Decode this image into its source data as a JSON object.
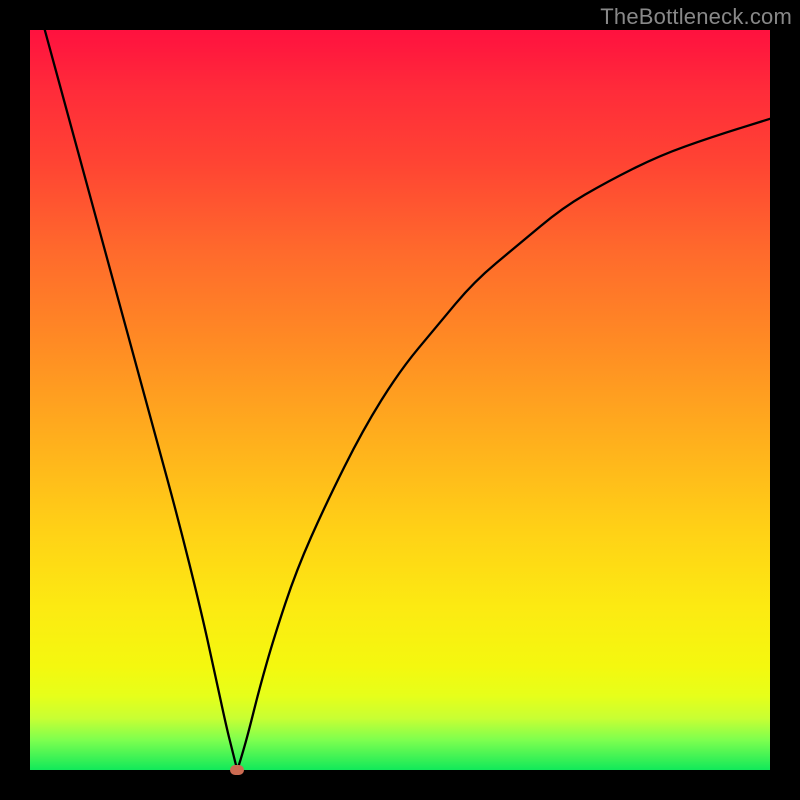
{
  "attribution": "TheBottleneck.com",
  "chart_data": {
    "type": "line",
    "title": "",
    "xlabel": "",
    "ylabel": "",
    "xlim": [
      0,
      100
    ],
    "ylim": [
      0,
      100
    ],
    "background_gradient": {
      "top": "#ff113f",
      "bottom": "#11e95a"
    },
    "minimum_point": {
      "x": 28,
      "y": 0
    },
    "series": [
      {
        "name": "bottleneck-curve",
        "x": [
          2,
          5,
          8,
          11,
          14,
          17,
          20,
          23,
          25,
          26.5,
          27.5,
          28,
          28.5,
          29.5,
          31,
          33,
          36,
          40,
          45,
          50,
          55,
          60,
          66,
          72,
          78,
          85,
          92,
          100
        ],
        "values": [
          100,
          89,
          78,
          67,
          56,
          45,
          34,
          22,
          13,
          6,
          2,
          0,
          1.5,
          5,
          11,
          18,
          27,
          36,
          46,
          54,
          60,
          66,
          71,
          76,
          79.5,
          83,
          85.5,
          88
        ]
      }
    ],
    "marker": {
      "x": 28,
      "y": 0,
      "color": "#cc6b52"
    }
  }
}
